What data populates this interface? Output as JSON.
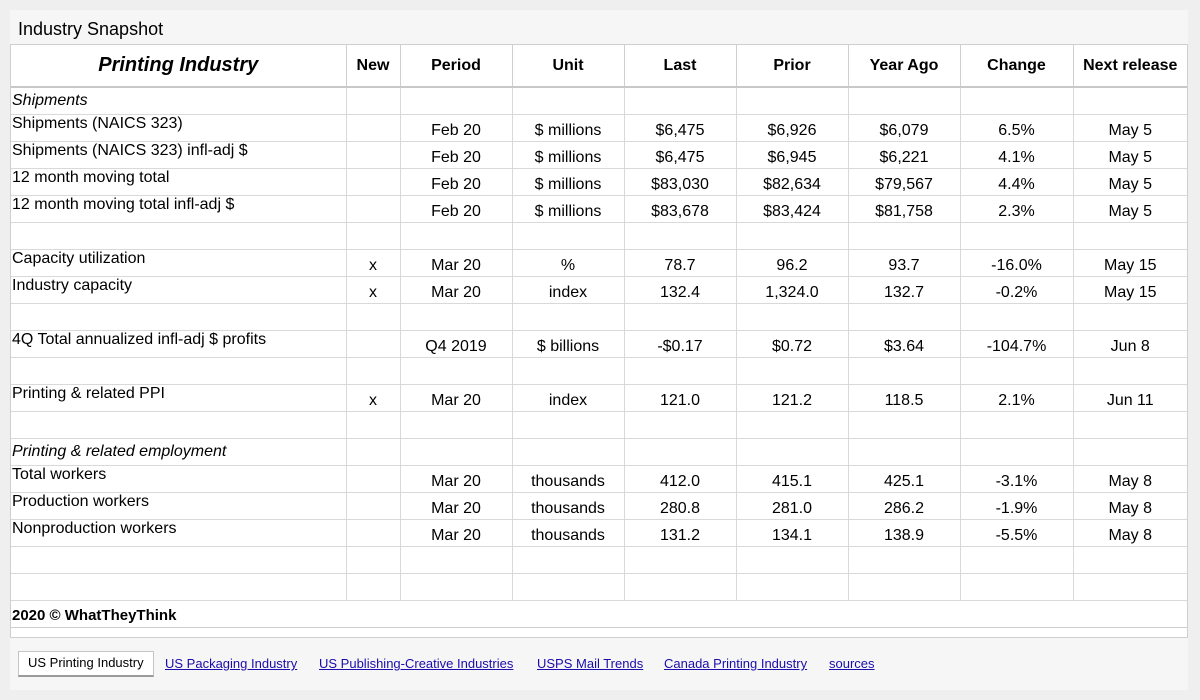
{
  "title": "Industry Snapshot",
  "table": {
    "headers": [
      "Printing Industry",
      "New",
      "Period",
      "Unit",
      "Last",
      "Prior",
      "Year Ago",
      "Change",
      "Next release"
    ],
    "rows": [
      {
        "kind": "section",
        "label": "Shipments"
      },
      {
        "kind": "data",
        "cells": [
          "Shipments (NAICS 323)",
          "",
          "Feb 20",
          "$ millions",
          "$6,475",
          "$6,926",
          "$6,079",
          "6.5%",
          "May 5"
        ]
      },
      {
        "kind": "data",
        "cells": [
          "Shipments (NAICS 323) infl-adj $",
          "",
          "Feb 20",
          "$ millions",
          "$6,475",
          "$6,945",
          "$6,221",
          "4.1%",
          "May 5"
        ]
      },
      {
        "kind": "data",
        "cells": [
          "12 month moving total",
          "",
          "Feb 20",
          "$ millions",
          "$83,030",
          "$82,634",
          "$79,567",
          "4.4%",
          "May 5"
        ]
      },
      {
        "kind": "data",
        "cells": [
          "12 month moving total infl-adj $",
          "",
          "Feb 20",
          "$ millions",
          "$83,678",
          "$83,424",
          "$81,758",
          "2.3%",
          "May 5"
        ]
      },
      {
        "kind": "blank"
      },
      {
        "kind": "data",
        "cells": [
          "Capacity utilization",
          "x",
          "Mar 20",
          "%",
          "78.7",
          "96.2",
          "93.7",
          "-16.0%",
          "May 15"
        ]
      },
      {
        "kind": "data",
        "cells": [
          "Industry capacity",
          "x",
          "Mar 20",
          "index",
          "132.4",
          "1,324.0",
          "132.7",
          "-0.2%",
          "May 15"
        ]
      },
      {
        "kind": "blank"
      },
      {
        "kind": "data",
        "cells": [
          "4Q Total annualized infl-adj $ profits",
          "",
          "Q4 2019",
          "$ billions",
          "-$0.17",
          "$0.72",
          "$3.64",
          "-104.7%",
          "Jun 8"
        ]
      },
      {
        "kind": "blank"
      },
      {
        "kind": "data",
        "cells": [
          "Printing & related PPI",
          "x",
          "Mar 20",
          "index",
          "121.0",
          "121.2",
          "118.5",
          "2.1%",
          "Jun 11"
        ]
      },
      {
        "kind": "blank"
      },
      {
        "kind": "section",
        "label": "Printing & related employment"
      },
      {
        "kind": "data",
        "cells": [
          "Total workers",
          "",
          "Mar 20",
          "thousands",
          "412.0",
          "415.1",
          "425.1",
          "-3.1%",
          "May 8"
        ]
      },
      {
        "kind": "data",
        "cells": [
          "Production workers",
          "",
          "Mar 20",
          "thousands",
          "280.8",
          "281.0",
          "286.2",
          "-1.9%",
          "May 8"
        ]
      },
      {
        "kind": "data",
        "cells": [
          "Nonproduction workers",
          "",
          "Mar 20",
          "thousands",
          "131.2",
          "134.1",
          "138.9",
          "-5.5%",
          "May 8"
        ]
      },
      {
        "kind": "blank"
      },
      {
        "kind": "blank"
      }
    ],
    "copyright": "2020 © WhatTheyThink"
  },
  "tabs": {
    "active": "US Printing Industry",
    "links": [
      "US Packaging Industry",
      "US Publishing-Creative Industries",
      "USPS Mail Trends",
      "Canada Printing Industry",
      "sources"
    ]
  },
  "colors": {
    "link": "#1a0dab",
    "grid": "#d9d9d9",
    "background": "#efefef"
  }
}
